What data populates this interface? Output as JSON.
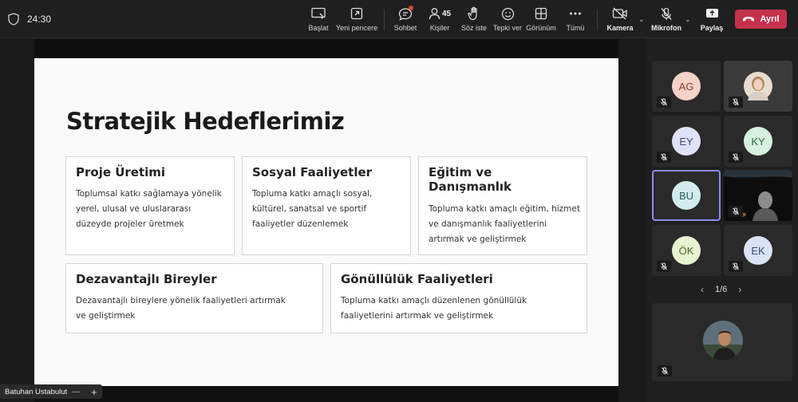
{
  "header": {
    "timer": "24:30",
    "toolbar": [
      {
        "id": "basla",
        "label": "Başlat"
      },
      {
        "id": "yeni",
        "label": "Yeni pencere"
      },
      {
        "id": "sohbet",
        "label": "Sohbet"
      },
      {
        "id": "kisiler",
        "label": "Kişiler",
        "count": "45"
      },
      {
        "id": "soz",
        "label": "Söz iste"
      },
      {
        "id": "tepki",
        "label": "Tepki ver"
      },
      {
        "id": "gorunum",
        "label": "Görünüm"
      },
      {
        "id": "tumu",
        "label": "Tümü"
      },
      {
        "id": "kamera",
        "label": "Kamera"
      },
      {
        "id": "mikrofon",
        "label": "Mikrofon"
      },
      {
        "id": "paylas",
        "label": "Paylaş"
      }
    ],
    "leave_label": "Ayrıl",
    "leave_color": "#c4314b"
  },
  "slide": {
    "title": "Stratejik Hedeflerimiz",
    "cards": [
      {
        "title": "Proje Üretimi",
        "body": "Toplumsal katkı sağlamaya yönelik yerel, ulusal ve uluslararası düzeyde projeler üretmek"
      },
      {
        "title": "Sosyal Faaliyetler",
        "body": "Topluma katkı amaçlı sosyal, kültürel, sanatsal ve sportif faaliyetler düzenlemek"
      },
      {
        "title": "Eğitim ve Danışmanlık",
        "body": "Topluma katkı amaçlı eğitim, hizmet ve danışmanlık faaliyetlerini artırmak ve geliştirmek"
      },
      {
        "title": "Dezavantajlı Bireyler",
        "body": "Dezavantajlı bireylere yönelik faaliyetleri artırmak ve geliştirmek"
      },
      {
        "title": "Gönüllülük Faaliyetleri",
        "body": "Topluma katkı amaçlı düzenlenen gönüllülük faaliyetlerini artırmak ve geliştirmek"
      }
    ]
  },
  "presenter": {
    "name": "Batuhan Ustabulut"
  },
  "participants": [
    {
      "initials": "AG",
      "color": "#f6d2c8"
    },
    {
      "initials": "",
      "photo": true
    },
    {
      "initials": "EY",
      "color": "#dfe3f8"
    },
    {
      "initials": "KY",
      "color": "#d6f2de"
    },
    {
      "initials": "BU",
      "color": "#d2ecec",
      "active": true
    },
    {
      "initials": "",
      "video": true
    },
    {
      "initials": "ÖK",
      "color": "#e6f4d2"
    },
    {
      "initials": "EK",
      "color": "#d9e3f5"
    }
  ],
  "pager": {
    "label": "1/6"
  }
}
